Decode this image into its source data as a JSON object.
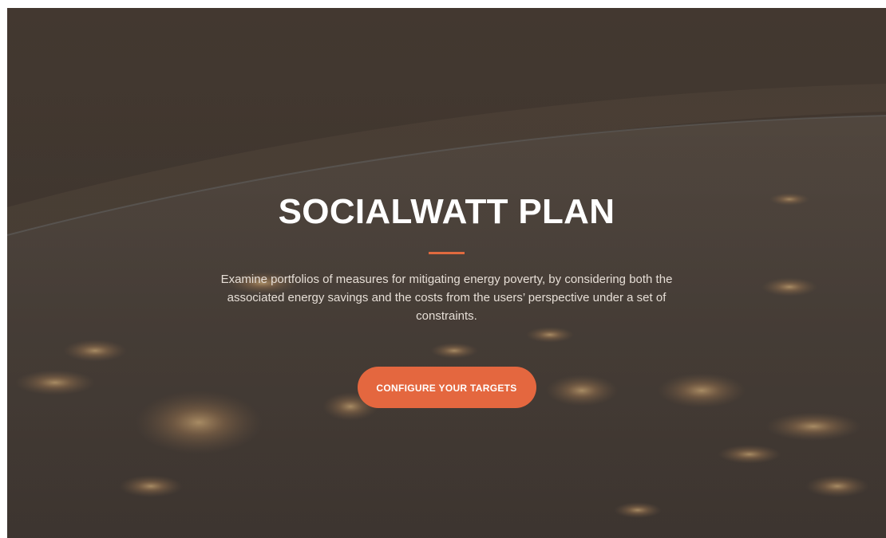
{
  "hero": {
    "title": "SOCIALWATT PLAN",
    "description": "Examine portfolios of measures for mitigating energy poverty, by considering both the associated energy savings and the costs from the users’ perspective under a set of constraints.",
    "cta_label": "CONFIGURE YOUR TARGETS",
    "background_image": "earth-at-night-from-space",
    "accent_color": "#e4673f"
  }
}
